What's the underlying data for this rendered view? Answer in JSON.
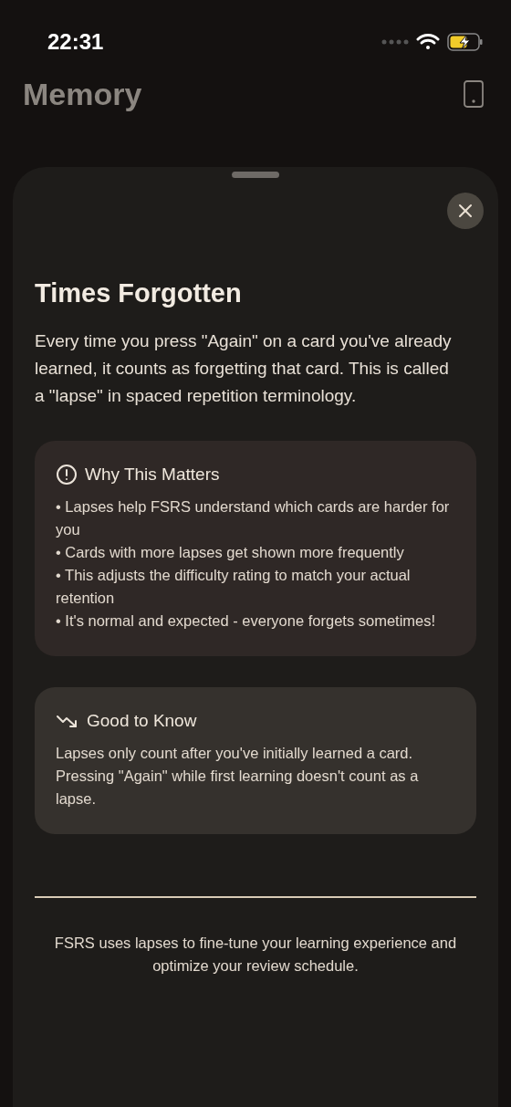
{
  "status_bar": {
    "time": "22:31"
  },
  "header": {
    "title": "Memory"
  },
  "sheet": {
    "title": "Times Forgotten",
    "body": "Every time you press \"Again\" on a card you've already learned, it counts as forgetting that card. This is called a \"lapse\" in spaced repetition terminology.",
    "cards": [
      {
        "kind": "warning",
        "title": "Why This Matters",
        "items": [
          "• Lapses help FSRS understand which cards are harder for you",
          "• Cards with more lapses get shown more frequently",
          "• This adjusts the difficulty rating to match your actual retention",
          "• It's normal and expected - everyone forgets sometimes!"
        ]
      },
      {
        "kind": "trend",
        "title": "Good to Know",
        "body": "Lapses only count after you've initially learned a card. Pressing \"Again\" while first learning doesn't count as a lapse."
      }
    ],
    "footer": "FSRS uses lapses to fine-tune your learning experience and optimize your review schedule."
  }
}
